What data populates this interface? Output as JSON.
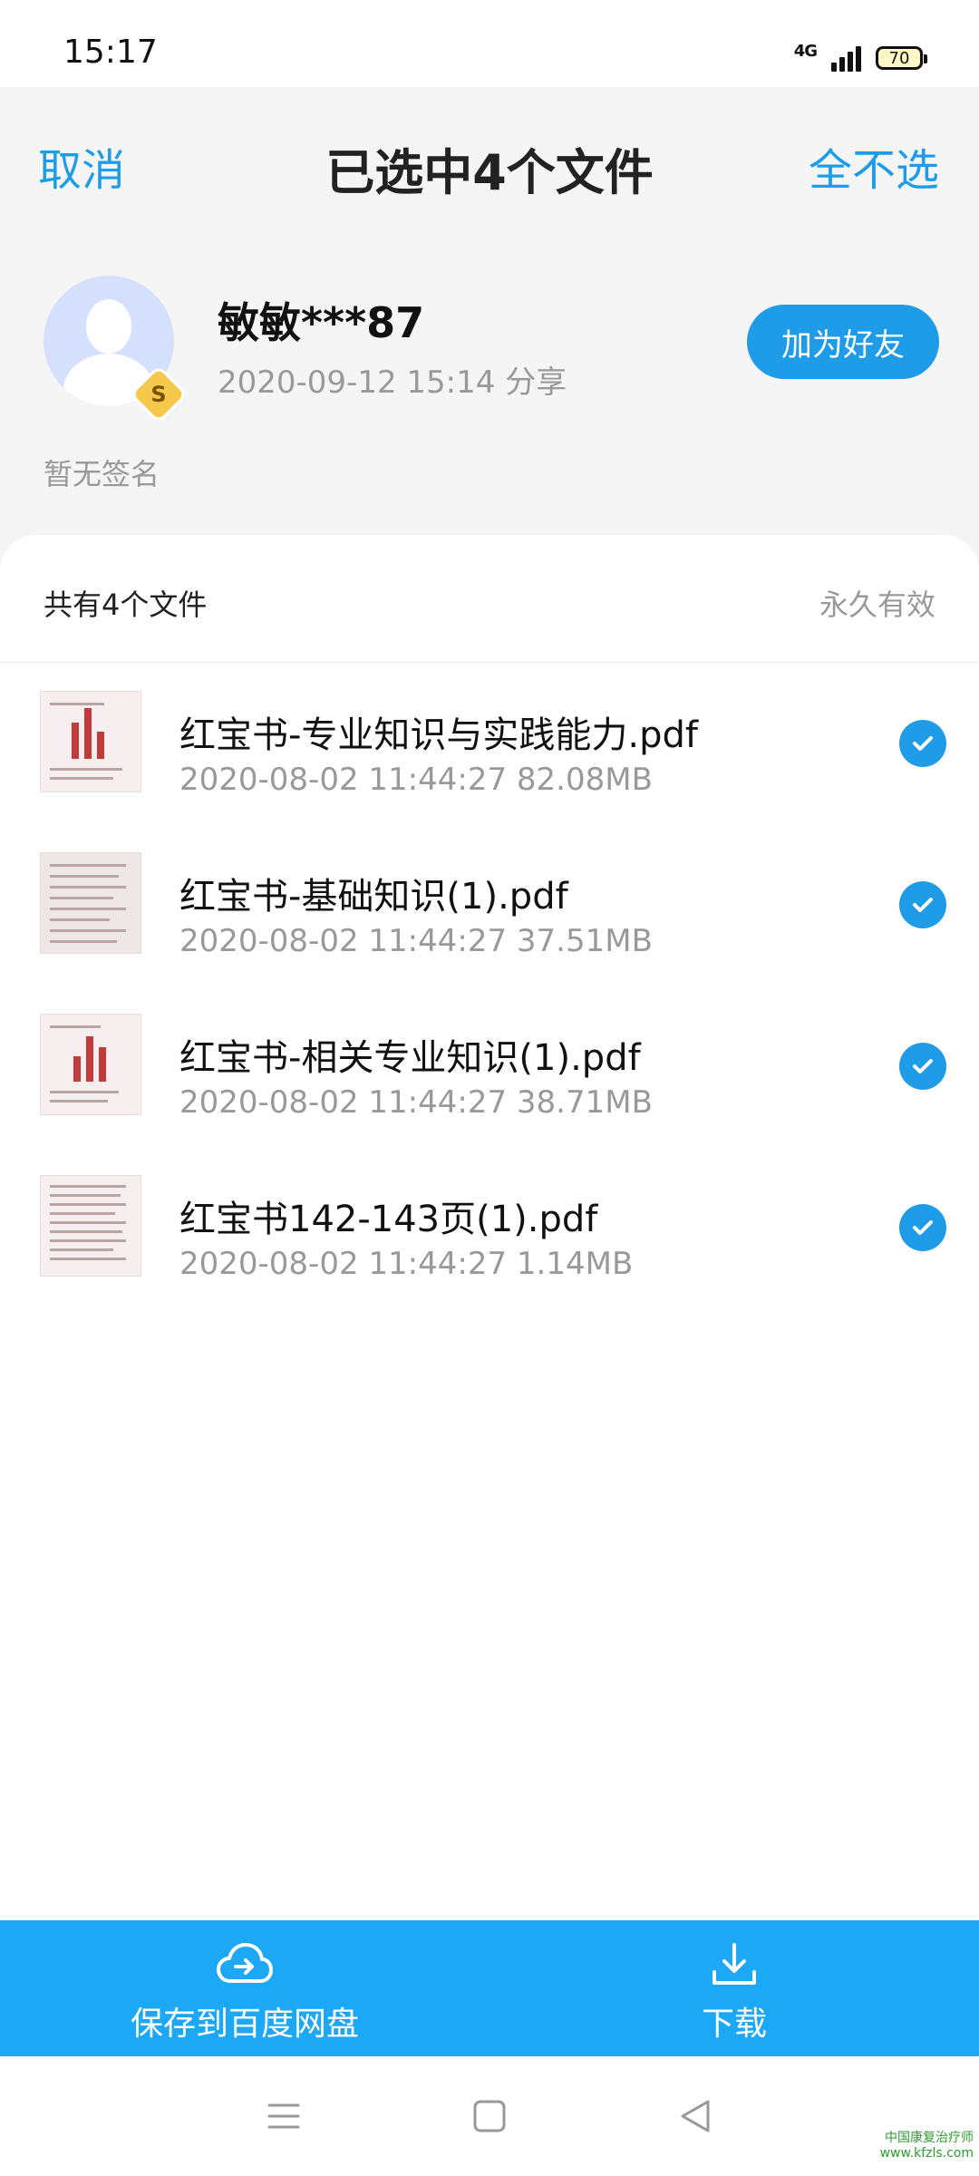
{
  "status_bar": {
    "time": "15:17",
    "network": "4G",
    "battery": "70"
  },
  "header": {
    "cancel_label": "取消",
    "title": "已选中4个文件",
    "deselect_all_label": "全不选"
  },
  "sharer": {
    "name": "敏敏***87",
    "meta": "2020-09-12 15:14  分享",
    "badge": "S",
    "add_friend_label": "加为好友",
    "signature": "暂无签名"
  },
  "files_card": {
    "count_label": "共有4个文件",
    "validity_label": "永久有效"
  },
  "files": [
    {
      "name": "红宝书-专业知识与实践能力.pdf",
      "meta": "2020-08-02  11:44:27  82.08MB",
      "selected": true
    },
    {
      "name": "红宝书-基础知识(1).pdf",
      "meta": "2020-08-02  11:44:27  37.51MB",
      "selected": true
    },
    {
      "name": "红宝书-相关专业知识(1).pdf",
      "meta": "2020-08-02  11:44:27  38.71MB",
      "selected": true
    },
    {
      "name": "红宝书142-143页(1).pdf",
      "meta": "2020-08-02  11:44:27  1.14MB",
      "selected": true
    }
  ],
  "actions": {
    "save_label": "保存到百度网盘",
    "download_label": "下载"
  },
  "watermark": {
    "line1": "中国康复治疗师",
    "line2": "www.kfzls.com"
  },
  "colors": {
    "accent": "#1e9ce8",
    "action_bar": "#1ca8f5"
  }
}
